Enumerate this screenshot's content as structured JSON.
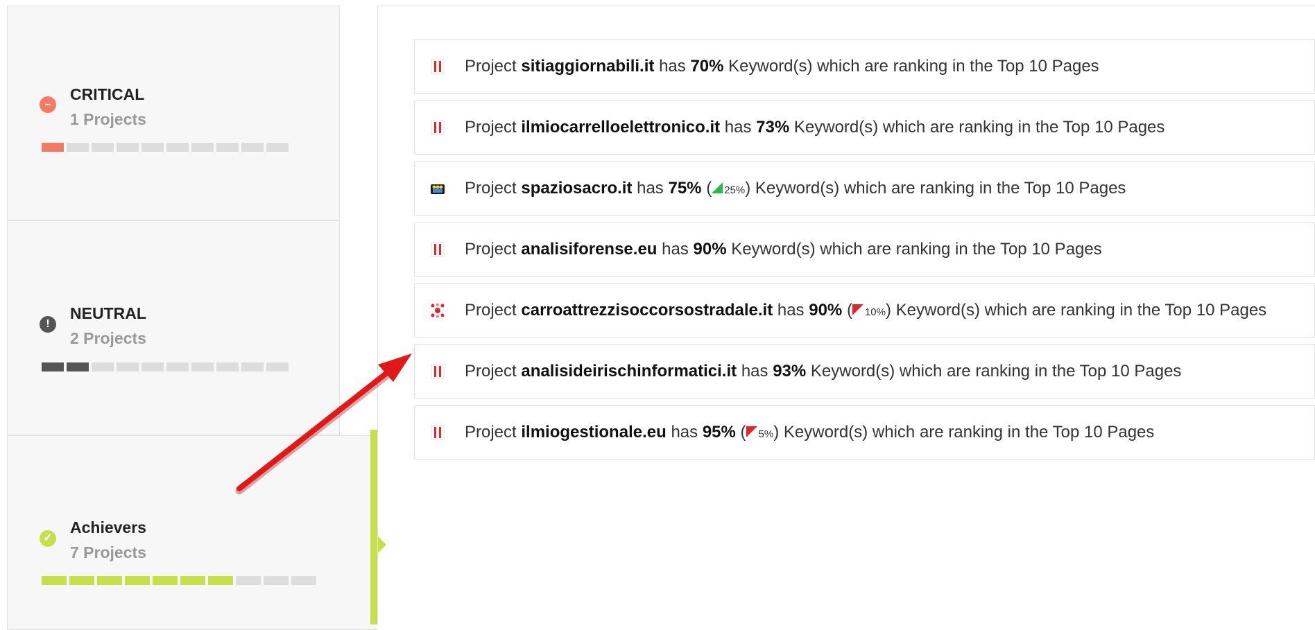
{
  "sidebar": {
    "cards": [
      {
        "title": "CRITICAL",
        "count": "1 Projects",
        "color": "#f47a63",
        "icon": "minus-circle-icon",
        "filled": 1,
        "total": 10
      },
      {
        "title": "NEUTRAL",
        "count": "2 Projects",
        "color": "#555555",
        "icon": "exclamation-circle-icon",
        "filled": 2,
        "total": 10
      },
      {
        "title": "Achievers",
        "count": "7 Projects",
        "color": "#c7e04a",
        "icon": "check-circle-icon",
        "filled": 7,
        "total": 10
      }
    ]
  },
  "projects": [
    {
      "prefix": "Project",
      "domain": "sitiaggiornabili.it",
      "has": "has",
      "percent": "70%",
      "delta": "",
      "delta_dir": "",
      "suffix": "Keyword(s) which are ranking in the Top 10 Pages",
      "favicon": "red-bars-favicon"
    },
    {
      "prefix": "Project",
      "domain": "ilmiocarrelloelettronico.it",
      "has": "has",
      "percent": "73%",
      "delta": "",
      "delta_dir": "",
      "suffix": "Keyword(s) which are ranking in the Top 10 Pages",
      "favicon": "red-bars-favicon"
    },
    {
      "prefix": "Project",
      "domain": "spaziosacro.it",
      "has": "has",
      "percent": "75%",
      "delta": "25%",
      "delta_dir": "up",
      "suffix": "Keyword(s) which are ranking in the Top 10 Pages",
      "favicon": "people-favicon"
    },
    {
      "prefix": "Project",
      "domain": "analisiforense.eu",
      "has": "has",
      "percent": "90%",
      "delta": "",
      "delta_dir": "",
      "suffix": "Keyword(s) which are ranking in the Top 10 Pages",
      "favicon": "red-bars-favicon"
    },
    {
      "prefix": "Project",
      "domain": "carroattrezzisoccorsostradale.it",
      "has": "has",
      "percent": "90%",
      "delta": "10%",
      "delta_dir": "down",
      "suffix": "Keyword(s) which are ranking in the Top 10 Pages",
      "favicon": "red-star-favicon"
    },
    {
      "prefix": "Project",
      "domain": "analisideirischinformatici.it",
      "has": "has",
      "percent": "93%",
      "delta": "",
      "delta_dir": "",
      "suffix": "Keyword(s) which are ranking in the Top 10 Pages",
      "favicon": "red-bars-favicon"
    },
    {
      "prefix": "Project",
      "domain": "ilmiogestionale.eu",
      "has": "has",
      "percent": "95%",
      "delta": "5%",
      "delta_dir": "down",
      "suffix": "Keyword(s) which are ranking in the Top 10 Pages",
      "favicon": "red-bars-favicon"
    }
  ],
  "colors": {
    "up": "#2db84b",
    "down": "#e8242b",
    "annotation_arrow": "#e01818"
  }
}
